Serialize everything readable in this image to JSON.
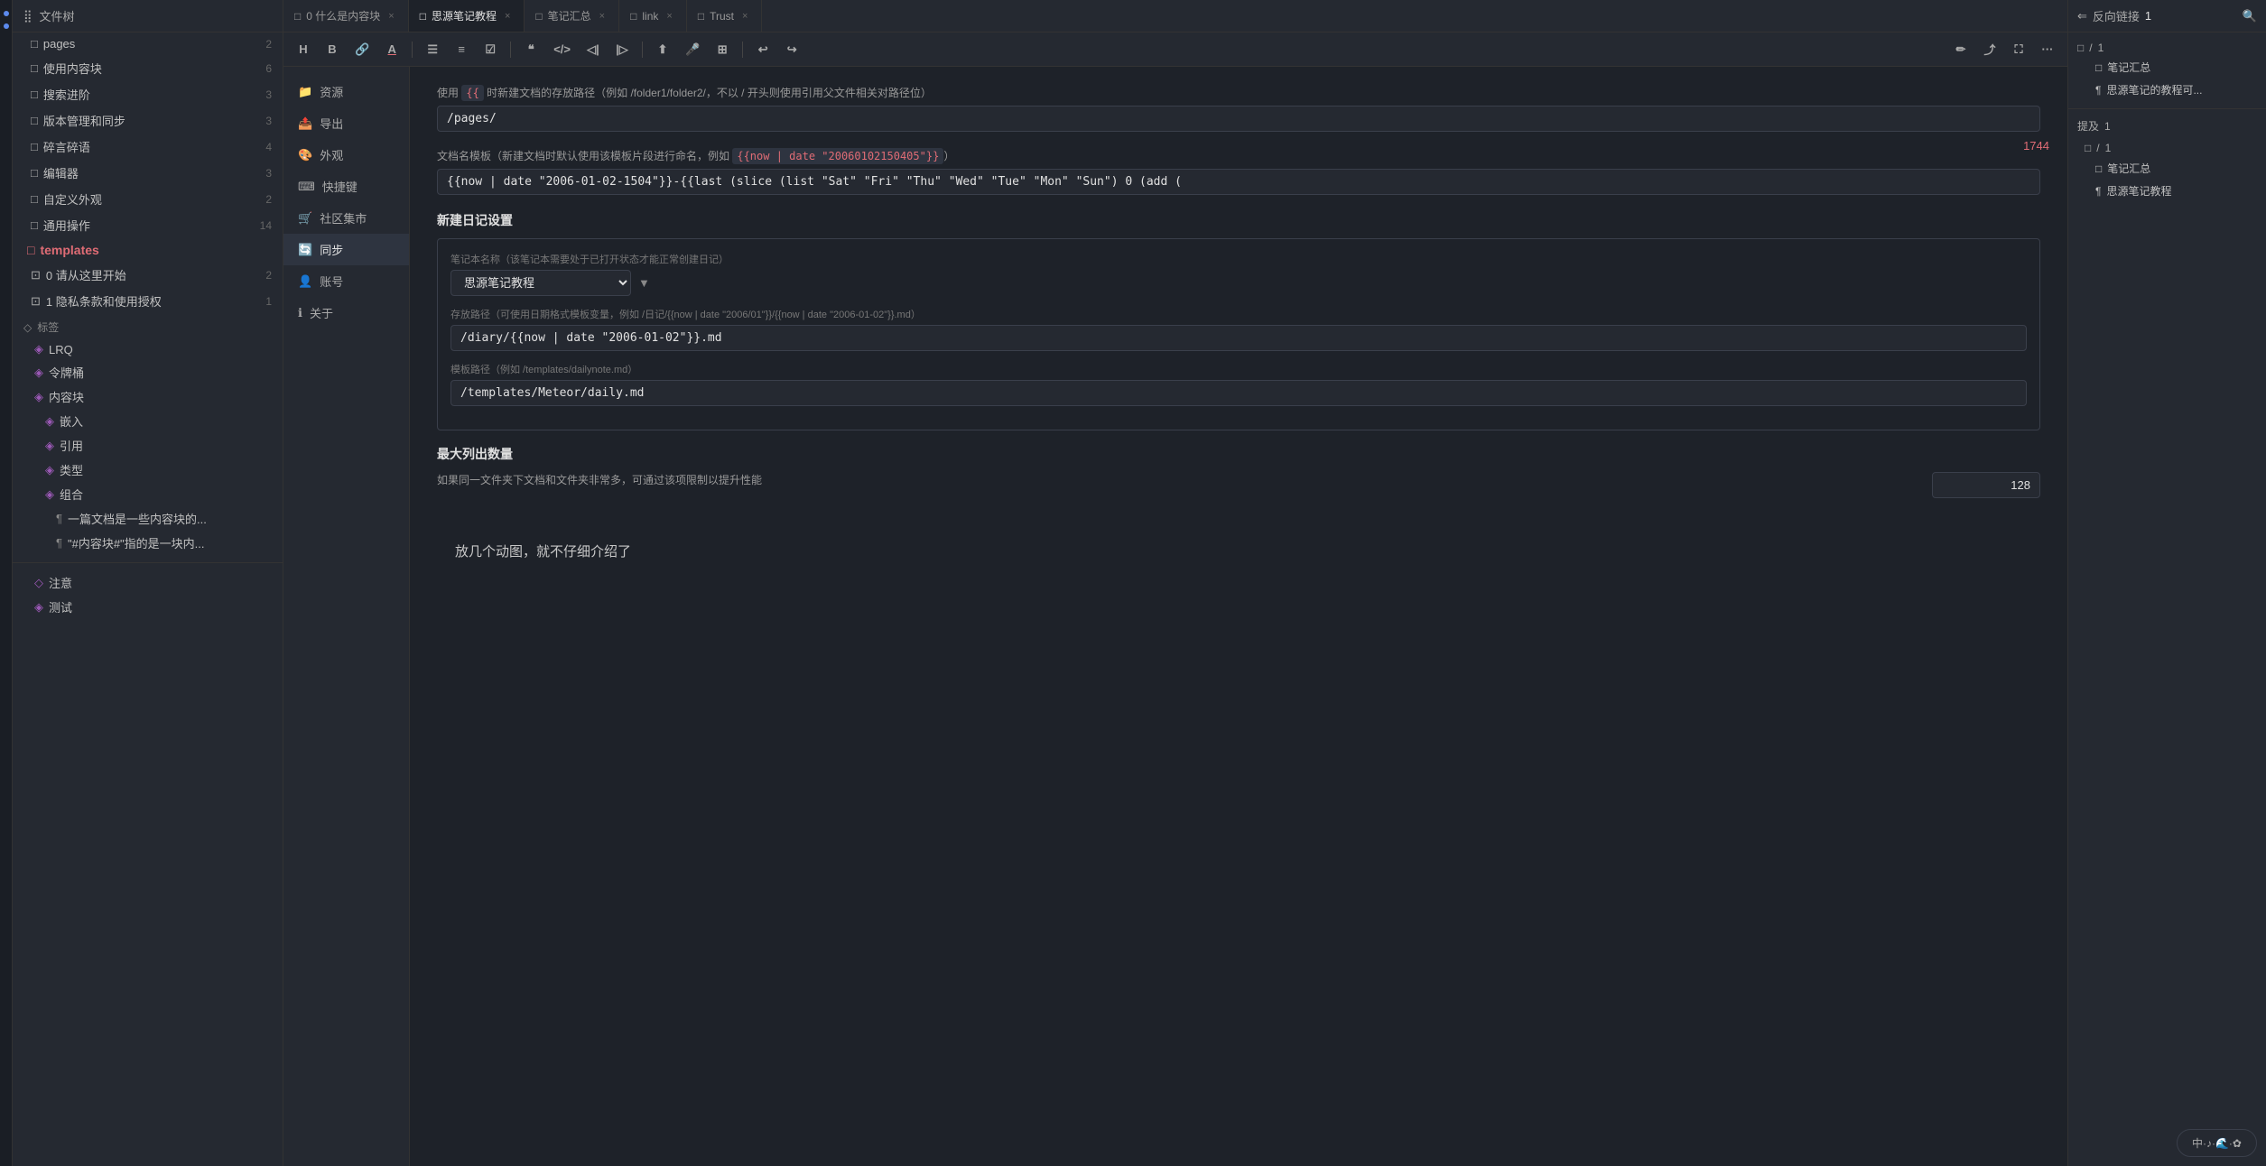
{
  "app": {
    "title": "文件树",
    "title_icon": "📄"
  },
  "sidebar": {
    "header": "文件树",
    "items": [
      {
        "id": "pages",
        "label": "pages",
        "icon": "folder",
        "badge": "2",
        "indent": 1
      },
      {
        "id": "use-content-block",
        "label": "使用内容块",
        "icon": "folder",
        "badge": "6",
        "indent": 1
      },
      {
        "id": "search-advanced",
        "label": "搜索进阶",
        "icon": "folder",
        "badge": "3",
        "indent": 1
      },
      {
        "id": "version-mgmt",
        "label": "版本管理和同步",
        "icon": "folder",
        "badge": "3",
        "indent": 1
      },
      {
        "id": "random-thoughts",
        "label": "碎言碎语",
        "icon": "folder",
        "badge": "4",
        "indent": 1
      },
      {
        "id": "editor",
        "label": "编辑器",
        "icon": "folder",
        "badge": "3",
        "indent": 1
      },
      {
        "id": "custom-appearance",
        "label": "自定义外观",
        "icon": "folder",
        "badge": "2",
        "indent": 1
      },
      {
        "id": "common-ops",
        "label": "通用操作",
        "icon": "folder",
        "badge": "14",
        "indent": 1
      },
      {
        "id": "templates",
        "label": "templates",
        "icon": "folder",
        "badge": "",
        "indent": 1,
        "special": true
      },
      {
        "id": "start-here",
        "label": "0 请从这里开始",
        "icon": "doc",
        "badge": "2",
        "indent": 1
      },
      {
        "id": "privacy",
        "label": "1 隐私条款和使用授权",
        "icon": "doc",
        "badge": "1",
        "indent": 1
      }
    ],
    "tags_section": "标签",
    "tags": [
      {
        "id": "LRQ",
        "label": "LRQ",
        "indent": 1
      },
      {
        "id": "token-bucket",
        "label": "令牌桶",
        "indent": 1
      },
      {
        "id": "content-block",
        "label": "内容块",
        "indent": 1
      },
      {
        "id": "embed",
        "label": "嵌入",
        "indent": 2
      },
      {
        "id": "quote",
        "label": "引用",
        "indent": 2
      },
      {
        "id": "type",
        "label": "类型",
        "indent": 2
      },
      {
        "id": "combination",
        "label": "组合",
        "indent": 2
      },
      {
        "id": "doc-is-blocks",
        "label": "一篇文档是一些内容块的...",
        "indent": 3,
        "type": "heading"
      },
      {
        "id": "content-block-hash",
        "label": "\"#内容块#\"指的是一块内...",
        "indent": 3,
        "type": "heading"
      }
    ],
    "bottom_tags": [
      {
        "id": "note",
        "label": "注意"
      },
      {
        "id": "test",
        "label": "测试"
      }
    ]
  },
  "tabs": [
    {
      "id": "what-is-content",
      "label": "0 什么是内容块",
      "active": false,
      "closable": true
    },
    {
      "id": "siyuan-tutorial",
      "label": "思源笔记教程",
      "active": true,
      "closable": true
    },
    {
      "id": "notes-summary",
      "label": "笔记汇总",
      "active": false,
      "closable": true
    },
    {
      "id": "link",
      "label": "link",
      "active": false,
      "closable": true
    },
    {
      "id": "trust",
      "label": "Trust",
      "active": false,
      "closable": true
    }
  ],
  "toolbar": {
    "buttons": [
      {
        "id": "heading",
        "label": "H"
      },
      {
        "id": "bold",
        "label": "B"
      },
      {
        "id": "link",
        "label": "🔗"
      },
      {
        "id": "font-color",
        "label": "A"
      },
      {
        "id": "list",
        "label": "≡"
      },
      {
        "id": "ordered-list",
        "label": "≡"
      },
      {
        "id": "checkbox",
        "label": "☑"
      },
      {
        "id": "quote-block",
        "label": "\"\""
      },
      {
        "id": "code",
        "label": "<>"
      },
      {
        "id": "indent-less",
        "label": "◁"
      },
      {
        "id": "indent-more",
        "label": "▷"
      },
      {
        "id": "upload",
        "label": "⬆"
      },
      {
        "id": "mic",
        "label": "🎤"
      },
      {
        "id": "table",
        "label": "⊞"
      },
      {
        "id": "undo",
        "label": "↩"
      },
      {
        "id": "redo",
        "label": "↪"
      },
      {
        "id": "edit",
        "label": "✏"
      },
      {
        "id": "export",
        "label": "⤴"
      },
      {
        "id": "fullscreen",
        "label": "⛶"
      },
      {
        "id": "more",
        "label": "···"
      }
    ]
  },
  "word_count": "1744",
  "settings": {
    "nav_items": [
      {
        "id": "resources",
        "label": "资源",
        "icon": "📁"
      },
      {
        "id": "export",
        "label": "导出",
        "icon": "📤"
      },
      {
        "id": "appearance",
        "label": "外观",
        "icon": "🎨"
      },
      {
        "id": "shortcuts",
        "label": "快捷键",
        "icon": "⌨"
      },
      {
        "id": "marketplace",
        "label": "社区集市",
        "icon": "🛒"
      },
      {
        "id": "sync",
        "label": "同步",
        "icon": "🔄"
      },
      {
        "id": "account",
        "label": "账号",
        "icon": "👤"
      },
      {
        "id": "about",
        "label": "关于",
        "icon": "ℹ"
      }
    ],
    "save_path_label": "使用 {{时新建文档的存放路径（例如 /folder1/folder2/，不以 / 开头则使用引用父文件相对路径位）",
    "save_path_value": "/pages/",
    "template_name_label": "文档名模板（新建文档时默认使用该模板片段进行命名，例如 {{now | date \"20060102150405\"}}）",
    "template_name_value": "{{now | date \"2006-01-02-1504\"}}-{{last (slice (list \"Sat\" \"Fri\" \"Thu\" \"Wed\" \"Tue\" \"Mon\" \"Sun\") 0 (add (",
    "diary_section_title": "新建日记设置",
    "diary_notebook_label": "笔记本名称（该笔记本需要处于已打开状态才能正常创建日记）",
    "diary_notebook_value": "思源笔记教程",
    "diary_save_path_label": "存放路径（可使用日期格式模板变量，例如 /日记/{{now | date \"2006/01\"}}/{{now | date \"2006-01-02\"}}.md）",
    "diary_save_path_value": "/diary/{{now | date \"2006-01-02\"}}.md",
    "template_path_label": "模板路径（例如 /templates/dailynote.md）",
    "template_path_value": "/templates/Meteor/daily.md",
    "max_list_label": "最大列出数量",
    "max_list_desc": "如果同一文件夹下文档和文件夹非常多，可通过该项限制以提升性能",
    "max_list_value": "128"
  },
  "main_content": {
    "text": "放几个动图，就不仔细介绍了"
  },
  "right_panel": {
    "title": "反向链接",
    "count": "1",
    "backlinks": {
      "section_label": "/",
      "section_count": "1",
      "items": [
        {
          "label": "笔记汇总"
        },
        {
          "label": "思源笔记的教程可..."
        }
      ]
    },
    "mentions": {
      "title": "提及",
      "count": "1",
      "section_label": "/",
      "section_count": "1",
      "items": [
        {
          "label": "笔记汇总"
        },
        {
          "label": "思源笔记教程"
        }
      ]
    }
  },
  "status_bar": {
    "text": "中·♪·🌊·✿"
  }
}
